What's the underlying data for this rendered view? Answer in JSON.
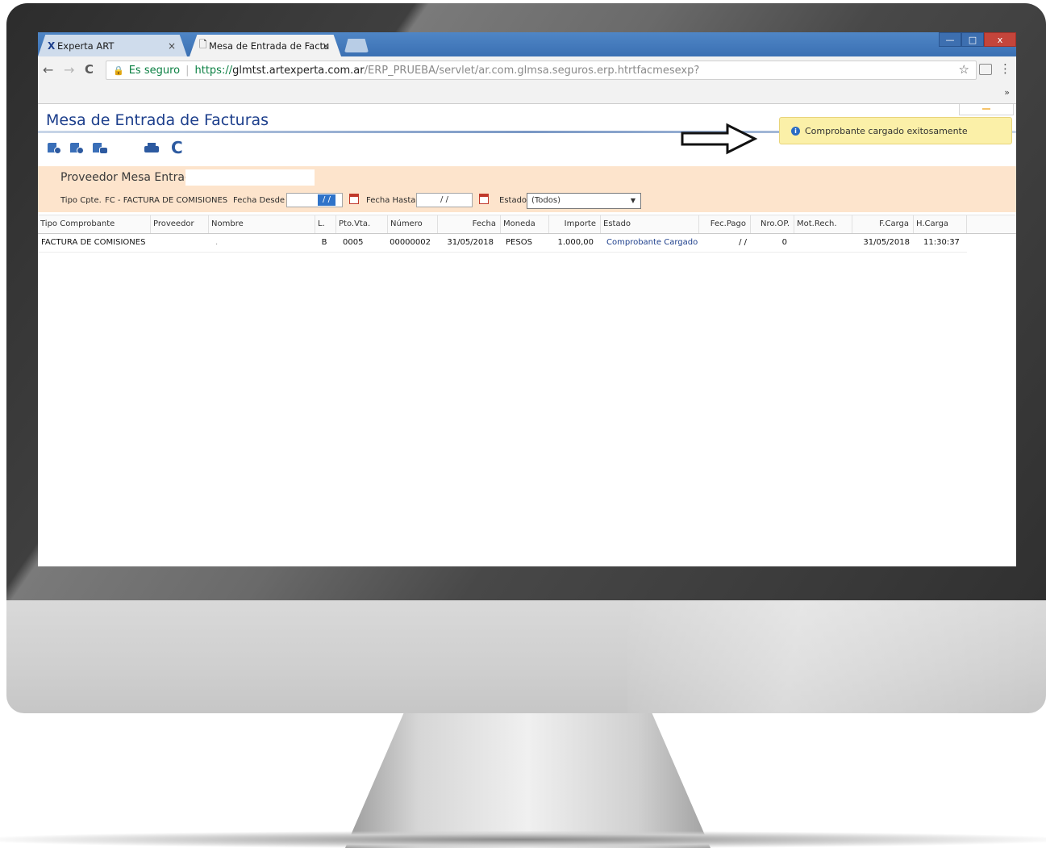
{
  "browser": {
    "tabs": [
      {
        "label": "Experta ART",
        "icon": "experta-x-icon",
        "close": "×"
      },
      {
        "label": "Mesa de Entrada de Factu",
        "icon": "page-icon",
        "close": "×"
      }
    ],
    "window_controls": {
      "minimize": "—",
      "maximize": "□",
      "close": "x"
    },
    "nav": {
      "back": "←",
      "forward": "→",
      "reload": "C"
    },
    "address": {
      "secure_label": "Es seguro",
      "url_prefix": "https://",
      "url_host": "glmtst.artexperta.com.ar",
      "url_path": "/ERP_PRUEBA/servlet/ar.com.glmsa.seguros.erp.htrtfacmesexp?"
    },
    "star": "☆",
    "menu": "⋮",
    "bookmarks_more": "»"
  },
  "page": {
    "title": "Mesa de Entrada de Facturas",
    "notification": "Comprobante cargado exitosamente",
    "filters": {
      "proveedor_label": "Proveedor Mesa Entrada",
      "tipo_cpte_label": "Tipo Cpte.",
      "tipo_cpte_value": "FC - FACTURA DE COMISIONES",
      "fecha_desde_label": "Fecha Desde",
      "fecha_desde_value": "/ /",
      "fecha_hasta_label": "Fecha Hasta",
      "fecha_hasta_value": "/ /",
      "estado_label": "Estado",
      "estado_value": "(Todos)"
    }
  },
  "grid": {
    "columns": [
      "Tipo Comprobante",
      "Proveedor",
      "Nombre",
      "L.",
      "Pto.Vta.",
      "Número",
      "Fecha",
      "Moneda",
      "Importe",
      "Estado",
      "Fec.Pago",
      "Nro.OP.",
      "Mot.Rech.",
      "F.Carga",
      "H.Carga"
    ],
    "rows": [
      {
        "tipo": "FACTURA DE COMISIONES",
        "proveedor": "",
        "nombre": ".",
        "letra": "B",
        "pto_vta": "0005",
        "numero": "00000002",
        "fecha": "31/05/2018",
        "moneda": "PESOS",
        "importe": "1.000,00",
        "estado": "Comprobante Cargado",
        "fec_pago": "/ /",
        "nro_op": "0",
        "mot_rech": "",
        "f_carga": "31/05/2018",
        "h_carga": "11:30:37"
      }
    ]
  },
  "colors": {
    "title_blue": "#1d3f8c",
    "filter_panel": "#fde4cc",
    "toast_bg": "#fbf0a8",
    "chrome_tabbar": "#3b70b3"
  },
  "icons": {
    "action_icons": [
      "upload-document-icon",
      "settings-document-icon",
      "view-document-icon",
      "printer-icon",
      "refresh-icon"
    ]
  }
}
